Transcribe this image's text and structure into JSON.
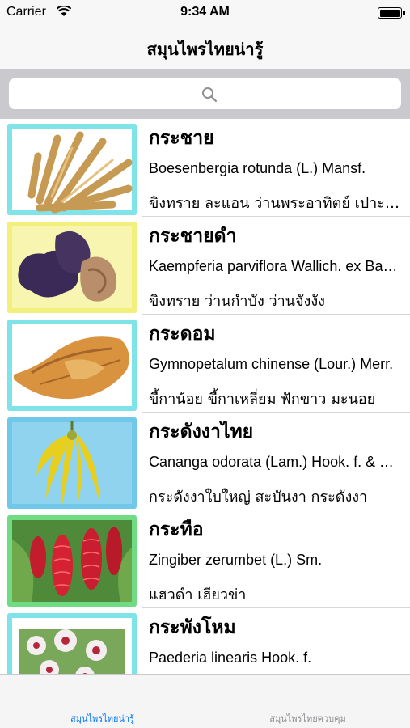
{
  "status_bar": {
    "carrier": "Carrier",
    "time": "9:34 AM"
  },
  "nav": {
    "title": "สมุนไพรไทยน่ารู้"
  },
  "search": {
    "placeholder": "",
    "icon": "search-icon"
  },
  "herbs": [
    {
      "name": "กระชาย",
      "scientific": "Boesenbergia rotunda (L.) Mansf.",
      "local_names": "ขิงทราย ละแอน ว่านพระอาทิตย์ เปาะซอ",
      "image": "rhizome-roots-photo",
      "frame_color": "#7fe3ea"
    },
    {
      "name": "กระชายดำ",
      "scientific": "Kaempferia parviflora Wallich. ex Baker",
      "local_names": "ขิงทราย ว่านกำบัง ว่านจังงัง",
      "image": "black-rhizome-photo",
      "frame_color": "#f2ef7a"
    },
    {
      "name": "กระดอม",
      "scientific": "Gymnopetalum chinense (Lour.) Merr.",
      "local_names": "ขี้กาน้อย ขี้กาเหลี่ยม ฟักขาว มะนอย",
      "image": "dried-fruit-photo",
      "frame_color": "#7fe3ea"
    },
    {
      "name": "กระดังงาไทย",
      "scientific": "Cananga odorata (Lam.) Hook. f. & Thomson",
      "local_names": "กระดังงาใบใหญ่ สะบันงา กระดังงา",
      "image": "yellow-flower-photo",
      "frame_color": "#6fc7ea"
    },
    {
      "name": "กระทือ",
      "scientific": "Zingiber zerumbet (L.) Sm.",
      "local_names": "แฮวดำ เฮียวข่า",
      "image": "red-ginger-flower-photo",
      "frame_color": "#6fdc83"
    },
    {
      "name": "กระพังโหม",
      "scientific": "Paederia linearis Hook. f.",
      "local_names": "",
      "image": "white-flower-photo",
      "frame_color": "#7fe3ea"
    }
  ],
  "tabs": [
    {
      "label": "สมุนไพรไทยน่ารู้",
      "active": true
    },
    {
      "label": "สมุนไพรไทยควบคุม",
      "active": false
    }
  ],
  "colors": {
    "accent": "#0a7af7",
    "bar_background": "#f7f7f7",
    "search_background": "#c9c9ce"
  }
}
